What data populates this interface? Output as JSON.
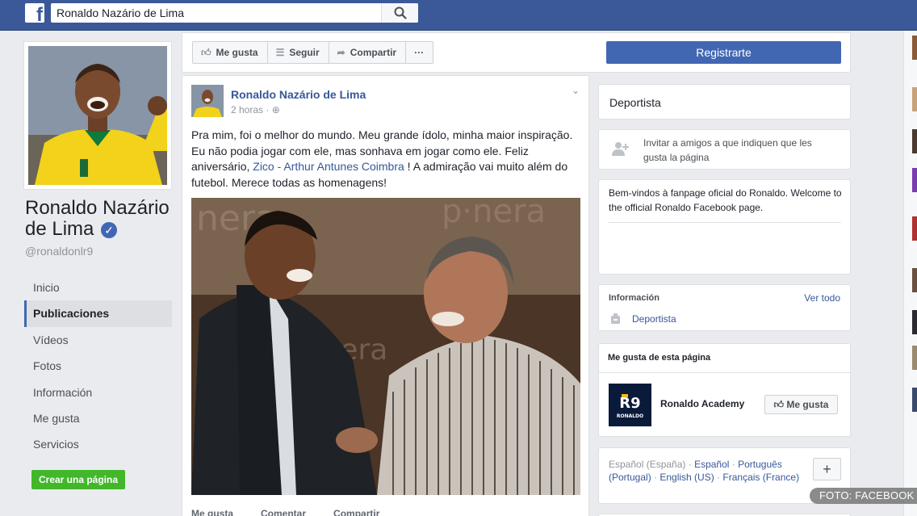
{
  "header": {
    "search_value": "Ronaldo Nazário de Lima"
  },
  "profile": {
    "name": "Ronaldo Nazário de Lima",
    "handle": "@ronaldonlr9"
  },
  "nav": {
    "items": [
      {
        "label": "Inicio"
      },
      {
        "label": "Publicaciones"
      },
      {
        "label": "Vídeos"
      },
      {
        "label": "Fotos"
      },
      {
        "label": "Información"
      },
      {
        "label": "Me gusta"
      },
      {
        "label": "Servicios"
      }
    ],
    "active": "Publicaciones",
    "create_page": "Crear una página"
  },
  "actions": {
    "like": "Me gusta",
    "follow": "Seguir",
    "share": "Compartir",
    "more": "···",
    "register": "Registrarte"
  },
  "post": {
    "author": "Ronaldo Nazário de Lima",
    "time": "2 horas ·",
    "text_before": "Pra mim, foi o melhor do mundo. Meu grande ídolo, minha maior inspiração. Eu não podia jogar com ele, mas sonhava em jogar como ele. Feliz aniversário, ",
    "link": "Zico - Arthur Antunes Coimbra",
    "text_after": " ! A admiração vai muito além do futebol. Merece todas as homenagens!",
    "photo_wall_text": "nera",
    "action_like": "Me gusta",
    "action_comment": "Comentar",
    "action_share": "Compartir"
  },
  "sidebar": {
    "category": "Deportista",
    "invite": "Invitar a amigos a que indiquen que les gusta la página",
    "about_text": "Bem-vindos à fanpage oficial do Ronaldo. Welcome to the official Ronaldo Facebook page.",
    "info_header": "Información",
    "info_see_all": "Ver todo",
    "info_category": "Deportista",
    "likes_header": "Me gusta de esta página",
    "liked_page_name": "Ronaldo Academy",
    "liked_page_logo": "R9",
    "liked_page_logo_sub": "RONALDO",
    "liked_page_button": "Me gusta",
    "lang_current": "Español (España)",
    "lang_dot": " · ",
    "lang_1": "Español",
    "lang_2": "Português (Portugal)",
    "lang_3": "English (US)",
    "lang_4": "Français (France)",
    "lang_plus": "+"
  },
  "watermark": "FOTO: FACEBOOK",
  "colors": {
    "brand": "#3b5998",
    "link": "#365899",
    "register": "#4267b2",
    "create_page": "#42b72a"
  }
}
